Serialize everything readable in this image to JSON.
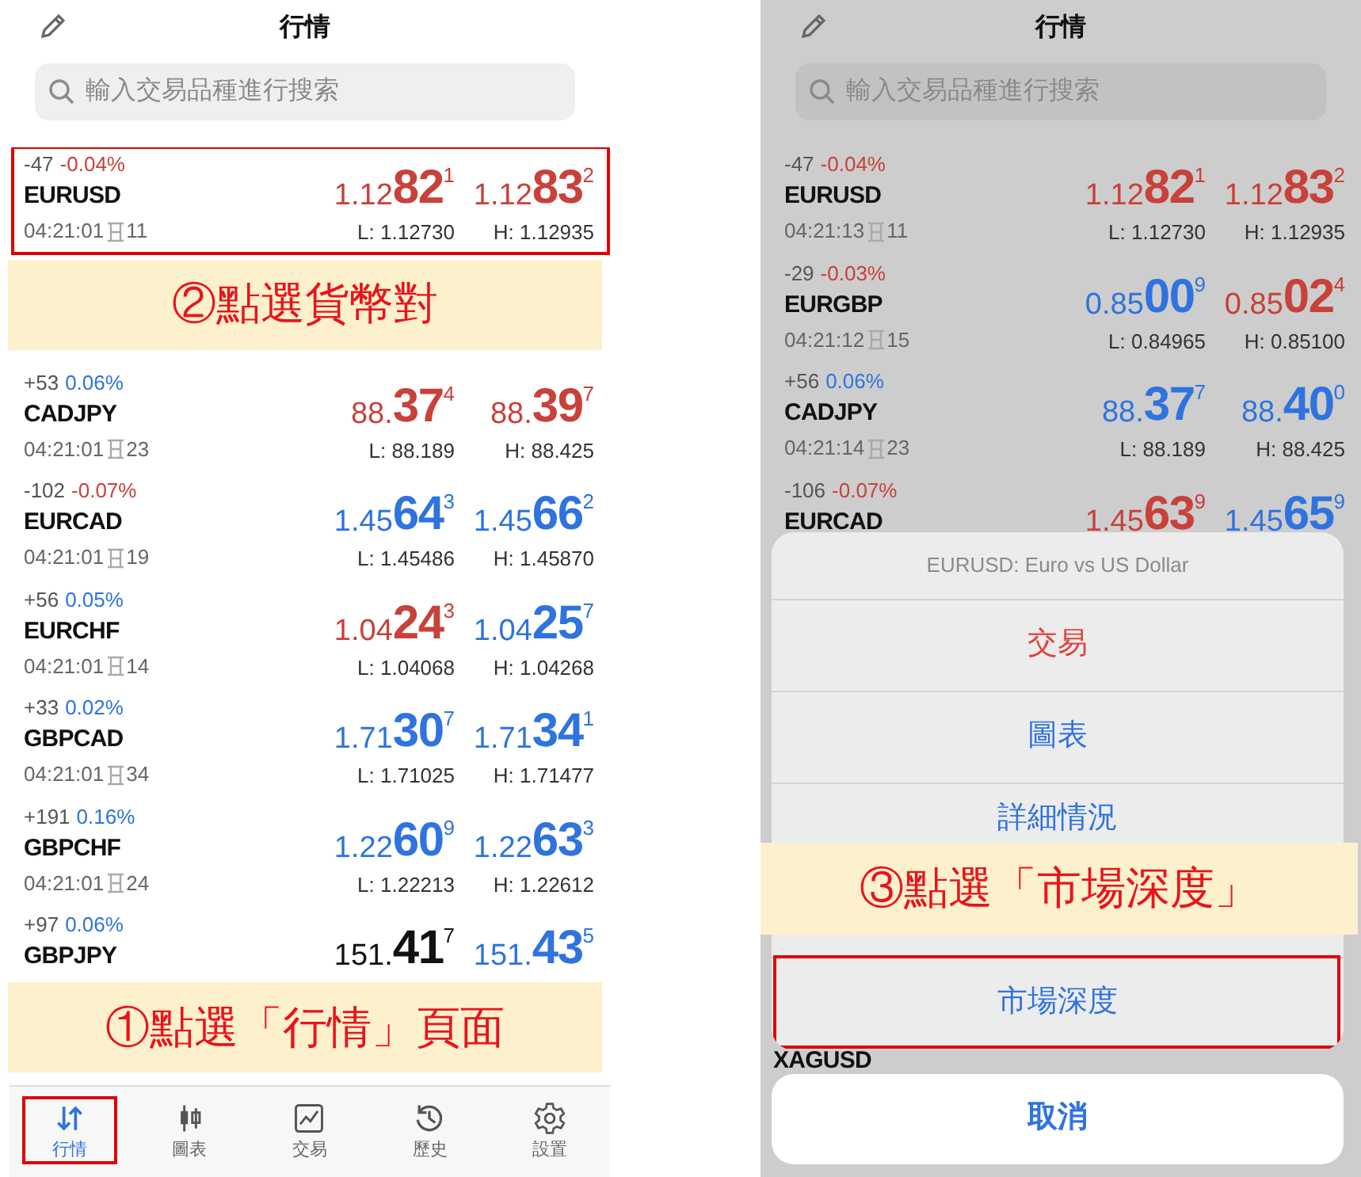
{
  "left_screen": {
    "title": "行情",
    "search": {
      "placeholder": "輸入交易品種進行搜索"
    },
    "list": [
      {
        "kind": "quote",
        "points": "-47",
        "percent": "-0.04%",
        "color": "#c8413a",
        "symbol": "EURUSD",
        "time": "04:21:01",
        "spread": "11",
        "highlighted": true,
        "bid": {
          "prefix": "1.12",
          "big": "82",
          "sup": "1",
          "color": "#c8413a"
        },
        "ask": {
          "prefix": "1.12",
          "big": "83",
          "sup": "2",
          "color": "#c8413a"
        },
        "low": "L: 1.12730",
        "high": "H: 1.12935"
      },
      {
        "kind": "banner",
        "text": "②點選貨幣對"
      },
      {
        "kind": "quote",
        "points": "+53",
        "percent": "0.06%",
        "color": "#2f73de",
        "symbol": "CADJPY",
        "time": "04:21:01",
        "spread": "23",
        "highlighted": false,
        "bid": {
          "prefix": "88.",
          "big": "37",
          "sup": "4",
          "color": "#c8413a"
        },
        "ask": {
          "prefix": "88.",
          "big": "39",
          "sup": "7",
          "color": "#c8413a"
        },
        "low": "L: 88.189",
        "high": "H: 88.425"
      },
      {
        "kind": "quote",
        "points": "-102",
        "percent": "-0.07%",
        "color": "#c8413a",
        "symbol": "EURCAD",
        "time": "04:21:01",
        "spread": "19",
        "highlighted": false,
        "bid": {
          "prefix": "1.45",
          "big": "64",
          "sup": "3",
          "color": "#2f73de"
        },
        "ask": {
          "prefix": "1.45",
          "big": "66",
          "sup": "2",
          "color": "#2f73de"
        },
        "low": "L: 1.45486",
        "high": "H: 1.45870"
      },
      {
        "kind": "quote",
        "points": "+56",
        "percent": "0.05%",
        "color": "#2f73de",
        "symbol": "EURCHF",
        "time": "04:21:01",
        "spread": "14",
        "highlighted": false,
        "bid": {
          "prefix": "1.04",
          "big": "24",
          "sup": "3",
          "color": "#c8413a"
        },
        "ask": {
          "prefix": "1.04",
          "big": "25",
          "sup": "7",
          "color": "#2f73de"
        },
        "low": "L: 1.04068",
        "high": "H: 1.04268"
      },
      {
        "kind": "quote",
        "points": "+33",
        "percent": "0.02%",
        "color": "#2f73de",
        "symbol": "GBPCAD",
        "time": "04:21:01",
        "spread": "34",
        "highlighted": false,
        "bid": {
          "prefix": "1.71",
          "big": "30",
          "sup": "7",
          "color": "#2f73de"
        },
        "ask": {
          "prefix": "1.71",
          "big": "34",
          "sup": "1",
          "color": "#2f73de"
        },
        "low": "L: 1.71025",
        "high": "H: 1.71477"
      },
      {
        "kind": "quote",
        "points": "+191",
        "percent": "0.16%",
        "color": "#2f73de",
        "symbol": "GBPCHF",
        "time": "04:21:01",
        "spread": "24",
        "highlighted": false,
        "bid": {
          "prefix": "1.22",
          "big": "60",
          "sup": "9",
          "color": "#2f73de"
        },
        "ask": {
          "prefix": "1.22",
          "big": "63",
          "sup": "3",
          "color": "#2f73de"
        },
        "low": "L: 1.22213",
        "high": "H: 1.22612"
      },
      {
        "kind": "quote",
        "points": "+97",
        "percent": "0.06%",
        "color": "#2f73de",
        "symbol": "GBPJPY",
        "highlighted": false,
        "bid": {
          "prefix": "151.",
          "big": "41",
          "sup": "7",
          "color": "#111111"
        },
        "ask": {
          "prefix": "151.",
          "big": "43",
          "sup": "5",
          "color": "#2f73de"
        }
      },
      {
        "kind": "banner",
        "text": "①點選「行情」頁面"
      }
    ],
    "tabs": [
      {
        "label": "行情",
        "selected": true,
        "highlighted": true
      },
      {
        "label": "圖表",
        "selected": false,
        "highlighted": false
      },
      {
        "label": "交易",
        "selected": false,
        "highlighted": false
      },
      {
        "label": "歷史",
        "selected": false,
        "highlighted": false
      },
      {
        "label": "設置",
        "selected": false,
        "highlighted": false
      }
    ]
  },
  "right_screen": {
    "title": "行情",
    "search": {
      "placeholder": "輸入交易品種進行搜索"
    },
    "list": [
      {
        "kind": "quote",
        "points": "-47",
        "percent": "-0.04%",
        "color": "#c8413a",
        "symbol": "EURUSD",
        "time": "04:21:13",
        "spread": "11",
        "highlighted": false,
        "bid": {
          "prefix": "1.12",
          "big": "82",
          "sup": "1",
          "color": "#c8413a"
        },
        "ask": {
          "prefix": "1.12",
          "big": "83",
          "sup": "2",
          "color": "#c8413a"
        },
        "low": "L: 1.12730",
        "high": "H: 1.12935"
      },
      {
        "kind": "quote",
        "points": "-29",
        "percent": "-0.03%",
        "color": "#c8413a",
        "symbol": "EURGBP",
        "time": "04:21:12",
        "spread": "15",
        "highlighted": false,
        "bid": {
          "prefix": "0.85",
          "big": "00",
          "sup": "9",
          "color": "#2f73de"
        },
        "ask": {
          "prefix": "0.85",
          "big": "02",
          "sup": "4",
          "color": "#c8413a"
        },
        "low": "L: 0.84965",
        "high": "H: 0.85100"
      },
      {
        "kind": "quote",
        "points": "+56",
        "percent": "0.06%",
        "color": "#2f73de",
        "symbol": "CADJPY",
        "time": "04:21:14",
        "spread": "23",
        "highlighted": false,
        "bid": {
          "prefix": "88.",
          "big": "37",
          "sup": "7",
          "color": "#2f73de"
        },
        "ask": {
          "prefix": "88.",
          "big": "40",
          "sup": "0",
          "color": "#2f73de"
        },
        "low": "L: 88.189",
        "high": "H: 88.425"
      },
      {
        "kind": "quote",
        "points": "-106",
        "percent": "-0.07%",
        "color": "#c8413a",
        "symbol": "EURCAD",
        "highlighted": false,
        "bid": {
          "prefix": "1.45",
          "big": "63",
          "sup": "9",
          "color": "#c8413a"
        },
        "ask": {
          "prefix": "1.45",
          "big": "65",
          "sup": "9",
          "color": "#2f73de"
        }
      }
    ],
    "peek_symbol": "XAGUSD",
    "sheet": {
      "title": "EURUSD: Euro vs US Dollar",
      "actions": [
        {
          "kind": "action",
          "label": "交易",
          "color": "#e0433a",
          "highlighted": false
        },
        {
          "kind": "action",
          "label": "圖表",
          "color": "#2f73de",
          "highlighted": false
        },
        {
          "kind": "action",
          "label": "詳細情況",
          "color": "#2f73de",
          "highlighted": false
        },
        {
          "kind": "covered"
        },
        {
          "kind": "action",
          "label": "市場深度",
          "color": "#2f73de",
          "highlighted": true
        }
      ],
      "cancel": "取消"
    },
    "banner": "③點選「市場深度」"
  }
}
